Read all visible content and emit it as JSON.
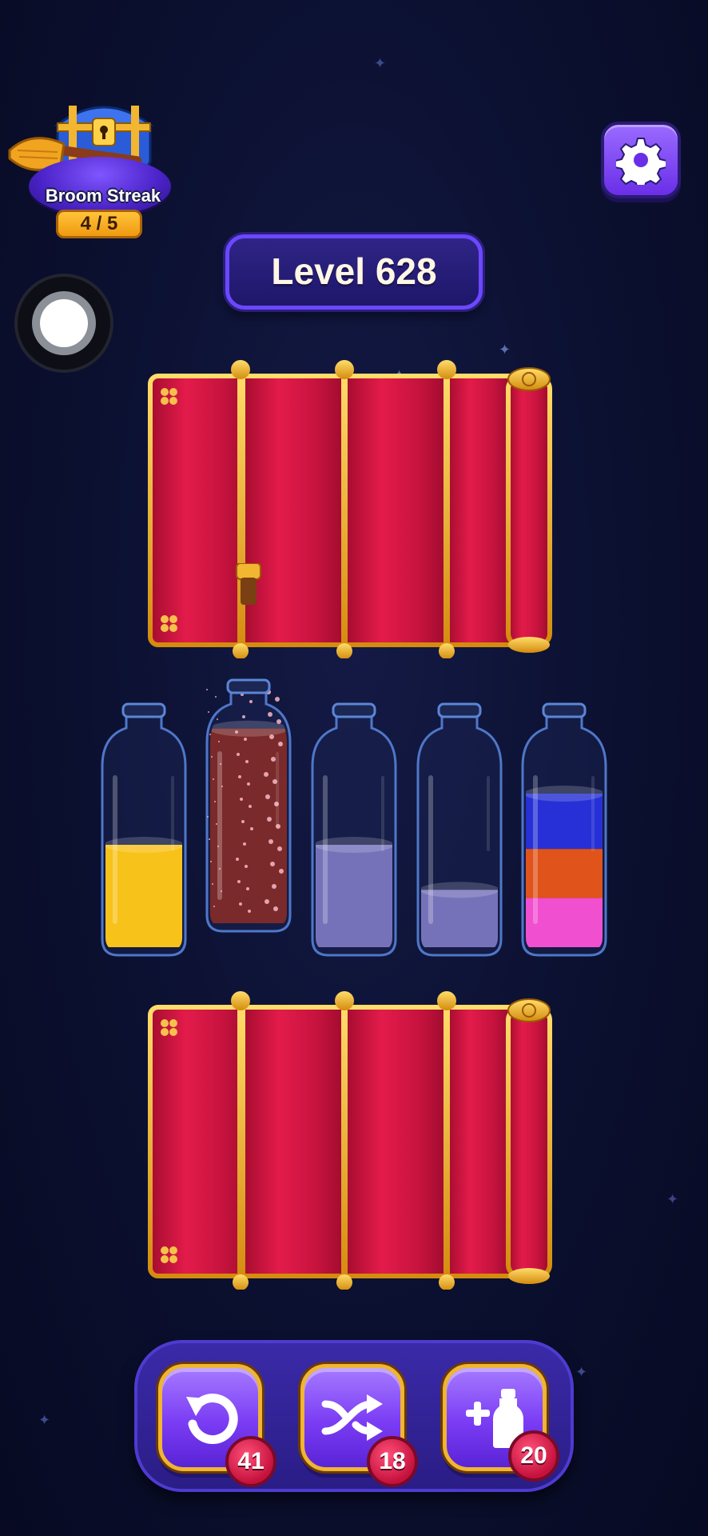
{
  "header": {
    "streak_label": "Broom Streak",
    "streak_count": "4 / 5",
    "level_label": "Level 628"
  },
  "icons": {
    "settings": "gear-icon",
    "record": "record-button",
    "streak": "treasure-chest-icon"
  },
  "bottles": [
    {
      "layers": [
        {
          "color": "#f7c21a",
          "fill": 0.5
        }
      ],
      "state": "normal"
    },
    {
      "layers": [
        {
          "color": "#7a2a2a",
          "fill": 0.95
        }
      ],
      "state": "hidden-sparkle"
    },
    {
      "layers": [
        {
          "color": "#7672ba",
          "fill": 0.5
        }
      ],
      "state": "normal"
    },
    {
      "layers": [
        {
          "color": "#7672ba",
          "fill": 0.28
        }
      ],
      "state": "normal"
    },
    {
      "layers": [
        {
          "color": "#f04fd0",
          "fill": 0.24
        },
        {
          "color": "#e0531a",
          "fill": 0.24
        },
        {
          "color": "#2630d6",
          "fill": 0.27
        }
      ],
      "state": "normal"
    }
  ],
  "powerups": [
    {
      "name": "undo",
      "icon": "undo-icon",
      "count": "41"
    },
    {
      "name": "shuffle",
      "icon": "shuffle-icon",
      "count": "18"
    },
    {
      "name": "add-bottle",
      "icon": "add-bottle-icon",
      "count": "20"
    }
  ],
  "colors": {
    "curtain": "#c8133f",
    "gold": "#f0b531",
    "accent": "#7a3cf4"
  }
}
